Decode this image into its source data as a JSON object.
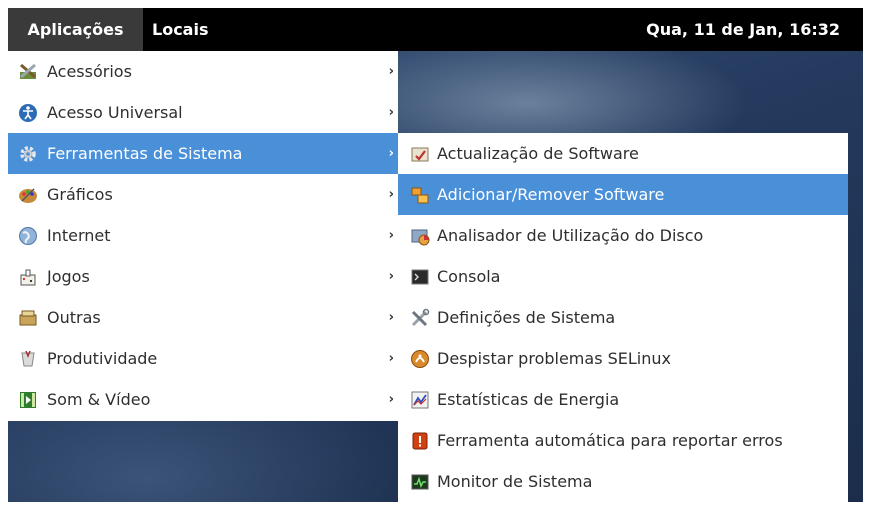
{
  "topbar": {
    "applications": "Aplicações",
    "places": "Locais",
    "clock": "Qua, 11 de Jan, 16:32"
  },
  "menu": {
    "items": [
      {
        "label": "Acessórios",
        "icon": "accessories-icon"
      },
      {
        "label": "Acesso Universal",
        "icon": "universal-access-icon"
      },
      {
        "label": "Ferramentas de Sistema",
        "icon": "gear-icon"
      },
      {
        "label": "Gráficos",
        "icon": "graphics-palette-icon"
      },
      {
        "label": "Internet",
        "icon": "globe-icon"
      },
      {
        "label": "Jogos",
        "icon": "games-icon"
      },
      {
        "label": "Outras",
        "icon": "box-icon"
      },
      {
        "label": "Produtividade",
        "icon": "office-icon"
      },
      {
        "label": "Som & Vídeo",
        "icon": "multimedia-icon"
      }
    ],
    "selected": "Ferramentas de Sistema",
    "arrow": "›"
  },
  "submenu": {
    "items": [
      {
        "label": "Actualização de Software",
        "icon": "software-update-icon"
      },
      {
        "label": "Adicionar/Remover Software",
        "icon": "package-icon"
      },
      {
        "label": "Analisador de Utilização do Disco",
        "icon": "disk-usage-icon"
      },
      {
        "label": "Consola",
        "icon": "terminal-icon"
      },
      {
        "label": "Definições de Sistema",
        "icon": "tools-icon"
      },
      {
        "label": "Despistar problemas SELinux",
        "icon": "selinux-icon"
      },
      {
        "label": "Estatísticas de Energia",
        "icon": "power-stats-icon"
      },
      {
        "label": "Ferramenta automática para reportar erros",
        "icon": "bug-report-icon"
      },
      {
        "label": "Monitor de Sistema",
        "icon": "system-monitor-icon"
      }
    ],
    "selected": "Adicionar/Remover Software"
  },
  "colors": {
    "selection": "#4a90d9",
    "topbar": "#000000"
  }
}
